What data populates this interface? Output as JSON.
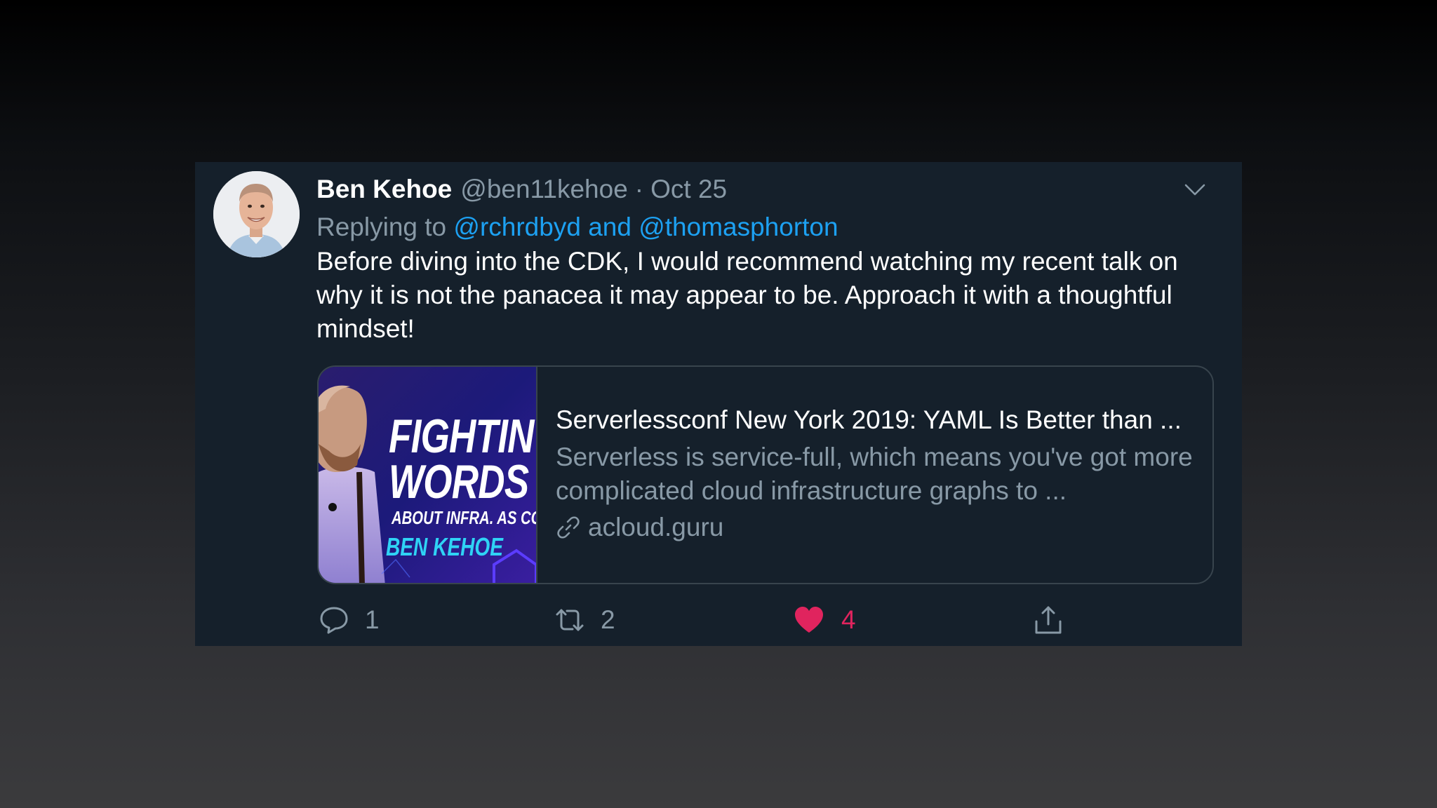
{
  "tweet": {
    "author_name": "Ben Kehoe",
    "author_handle": "@ben11kehoe",
    "separator": "·",
    "date": "Oct 25",
    "replying_prefix": "Replying to",
    "reply_mentions": [
      "@rchrdbyd",
      "@thomasphorton"
    ],
    "reply_conjunction": "and",
    "text": "Before diving into the CDK, I would recommend watching my recent talk on why it is not the panacea it may appear to be. Approach it with a thoughtful mindset!",
    "card": {
      "title": "Serverlessconf New York 2019: YAML Is Better than ...",
      "description": "Serverless is service-full, which means you've got more complicated cloud infrastructure graphs to ...",
      "domain": "acloud.guru",
      "thumbnail_text": [
        "FIGHTIN",
        "WORDS",
        "ABOUT INFRA. AS COD",
        "BEN KEHOE"
      ]
    },
    "actions": {
      "reply_count": "1",
      "retweet_count": "2",
      "like_count": "4"
    }
  },
  "colors": {
    "background": "#15202b",
    "accent": "#1da1f2",
    "secondary_text": "#8899a6",
    "like": "#e0245e",
    "border": "#38444d"
  },
  "icons": [
    "chevron-down-icon",
    "link-icon",
    "reply-icon",
    "retweet-icon",
    "heart-icon",
    "share-icon"
  ]
}
